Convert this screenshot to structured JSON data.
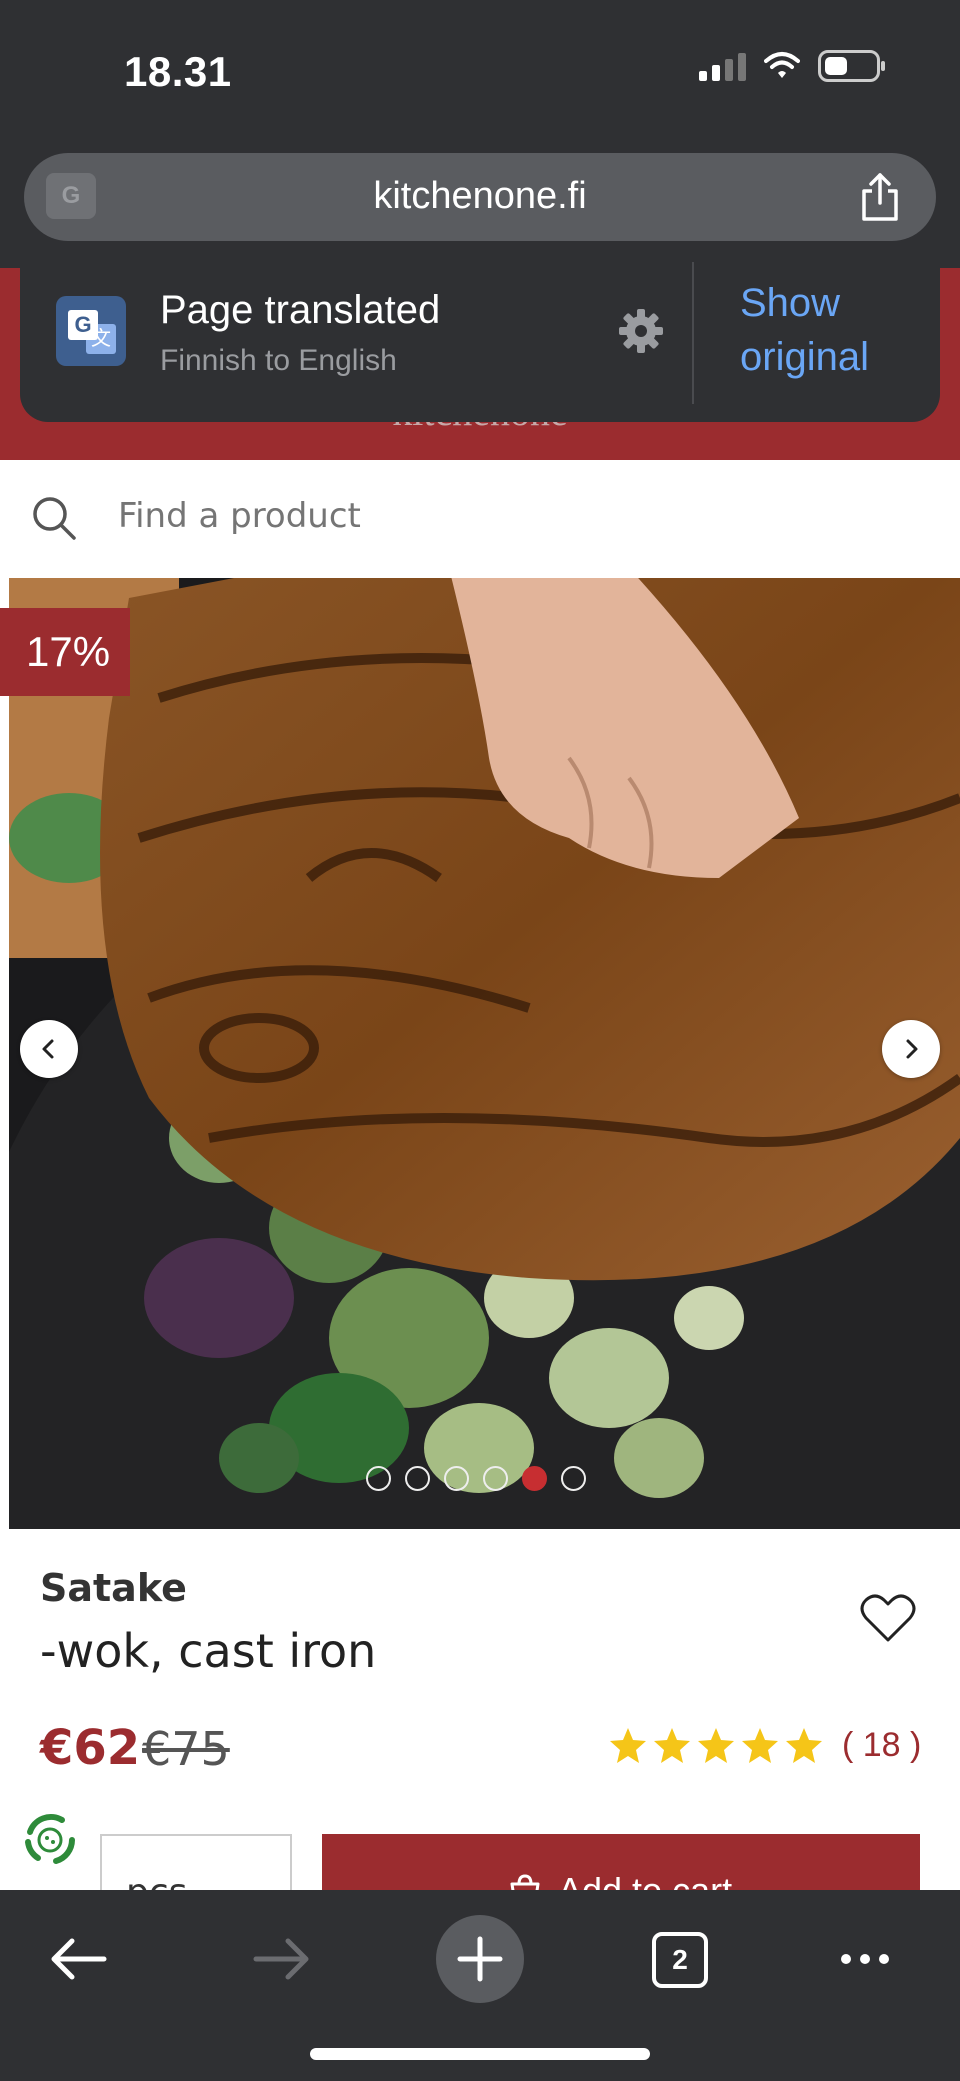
{
  "status_bar": {
    "time": "18.31"
  },
  "browser": {
    "url": "kitchenone.fi",
    "translate_badge": "G",
    "open_tabs": "2"
  },
  "translate_popup": {
    "title": "Page translated",
    "subtitle": "Finnish to English",
    "show_original": "Show original"
  },
  "site": {
    "logo_text": "kitchenone"
  },
  "search": {
    "placeholder": "Find a product"
  },
  "gallery": {
    "discount": "17%",
    "dot_count": 6,
    "active_dot": 5
  },
  "product": {
    "brand": "Satake",
    "name": "-wok, cast iron",
    "price": "€62",
    "old_price": "€75",
    "rating_stars": 5,
    "review_count": "( 18 )"
  },
  "purchase": {
    "qty_label": "pcs",
    "add_to_cart": "Add to cart"
  },
  "colors": {
    "brand_red": "#9b2c2f",
    "chrome_dark": "#2f3033",
    "link_blue": "#6aa6f5",
    "star_yellow": "#f5c518"
  },
  "icons": [
    "translate-icon",
    "share-icon",
    "settings-gear-icon",
    "search-icon",
    "chevron-left-icon",
    "chevron-right-icon",
    "heart-icon",
    "star-icon",
    "recycle-icon",
    "cart-icon",
    "back-arrow-icon",
    "forward-arrow-icon",
    "plus-icon",
    "tabs-icon",
    "more-icon"
  ]
}
